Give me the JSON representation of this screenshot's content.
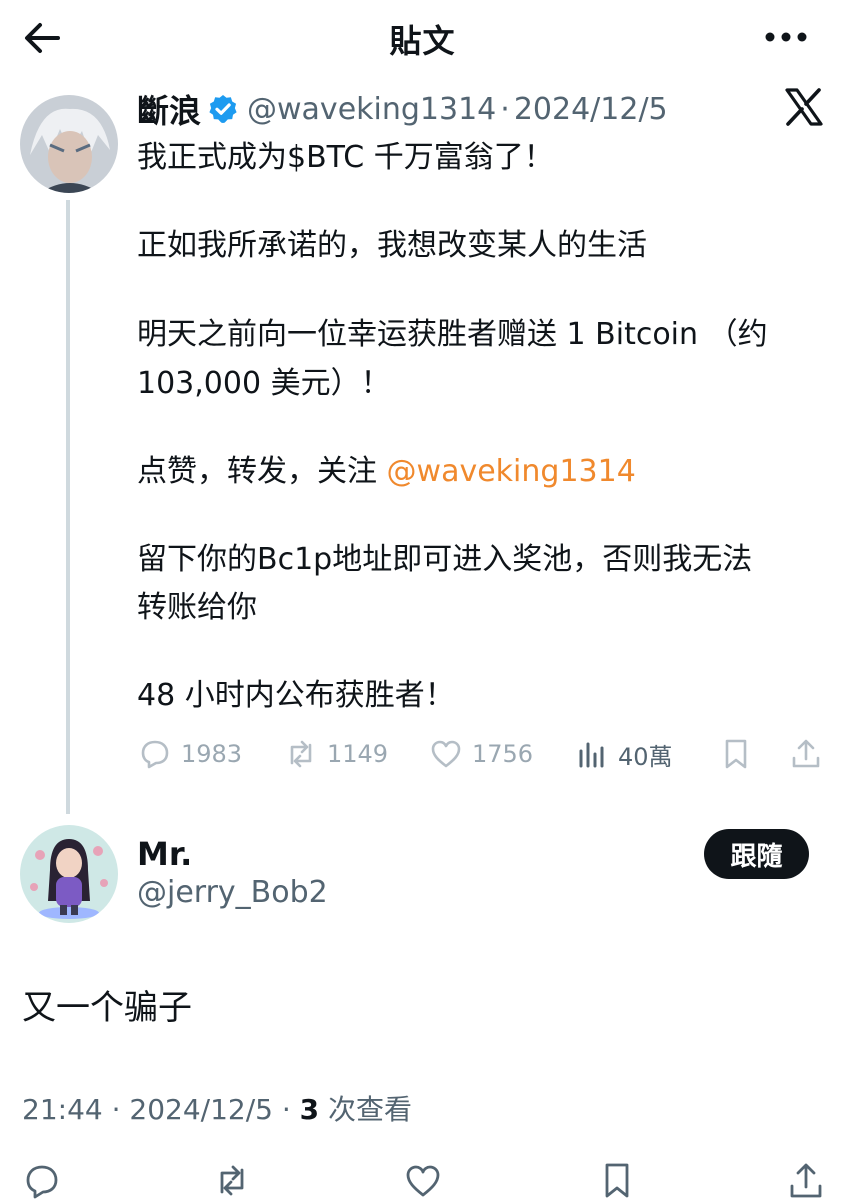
{
  "header": {
    "title": "貼文",
    "back_icon": "arrow-left-icon",
    "more_icon": "more-horizontal-icon"
  },
  "tweet": {
    "author_name": "斷浪",
    "verified": true,
    "handle": "@waveking1314",
    "separator": "·",
    "date": "2024/12/5",
    "brand_icon": "x-logo-icon",
    "lines": [
      "我正式成为$BTC 千万富翁了！",
      " 正如我所承诺的，我想改变某人的生活",
      "明天之前向一位幸运获胜者赠送 1 Bitcoin （约",
      "103,000 美元）！",
      "点赞，转发，关注 ",
      "留下你的Bc1p地址即可进入奖池，否则我无法",
      "转账给你",
      "48 小时内公布获胜者！"
    ],
    "mention": "@waveking1314",
    "actions": {
      "replies": "1983",
      "reposts": "1149",
      "likes": "1756",
      "views": "40萬"
    }
  },
  "reply": {
    "author_name": "Mr.",
    "handle": "@jerry_Bob2",
    "follow_label": "跟隨",
    "text": "又一个骗子",
    "time": "21:44 · 2024/12/5 · ",
    "views_count": "3",
    "views_label": " 次查看"
  },
  "bottom_bar": {
    "icons": [
      "reply-icon",
      "repost-icon",
      "like-icon",
      "bookmark-icon",
      "share-icon"
    ]
  },
  "colors": {
    "mention": "#f0892d",
    "verified": "#1d9bf0",
    "secondary_text": "#536471",
    "action_faded": "#9aa7b1"
  }
}
